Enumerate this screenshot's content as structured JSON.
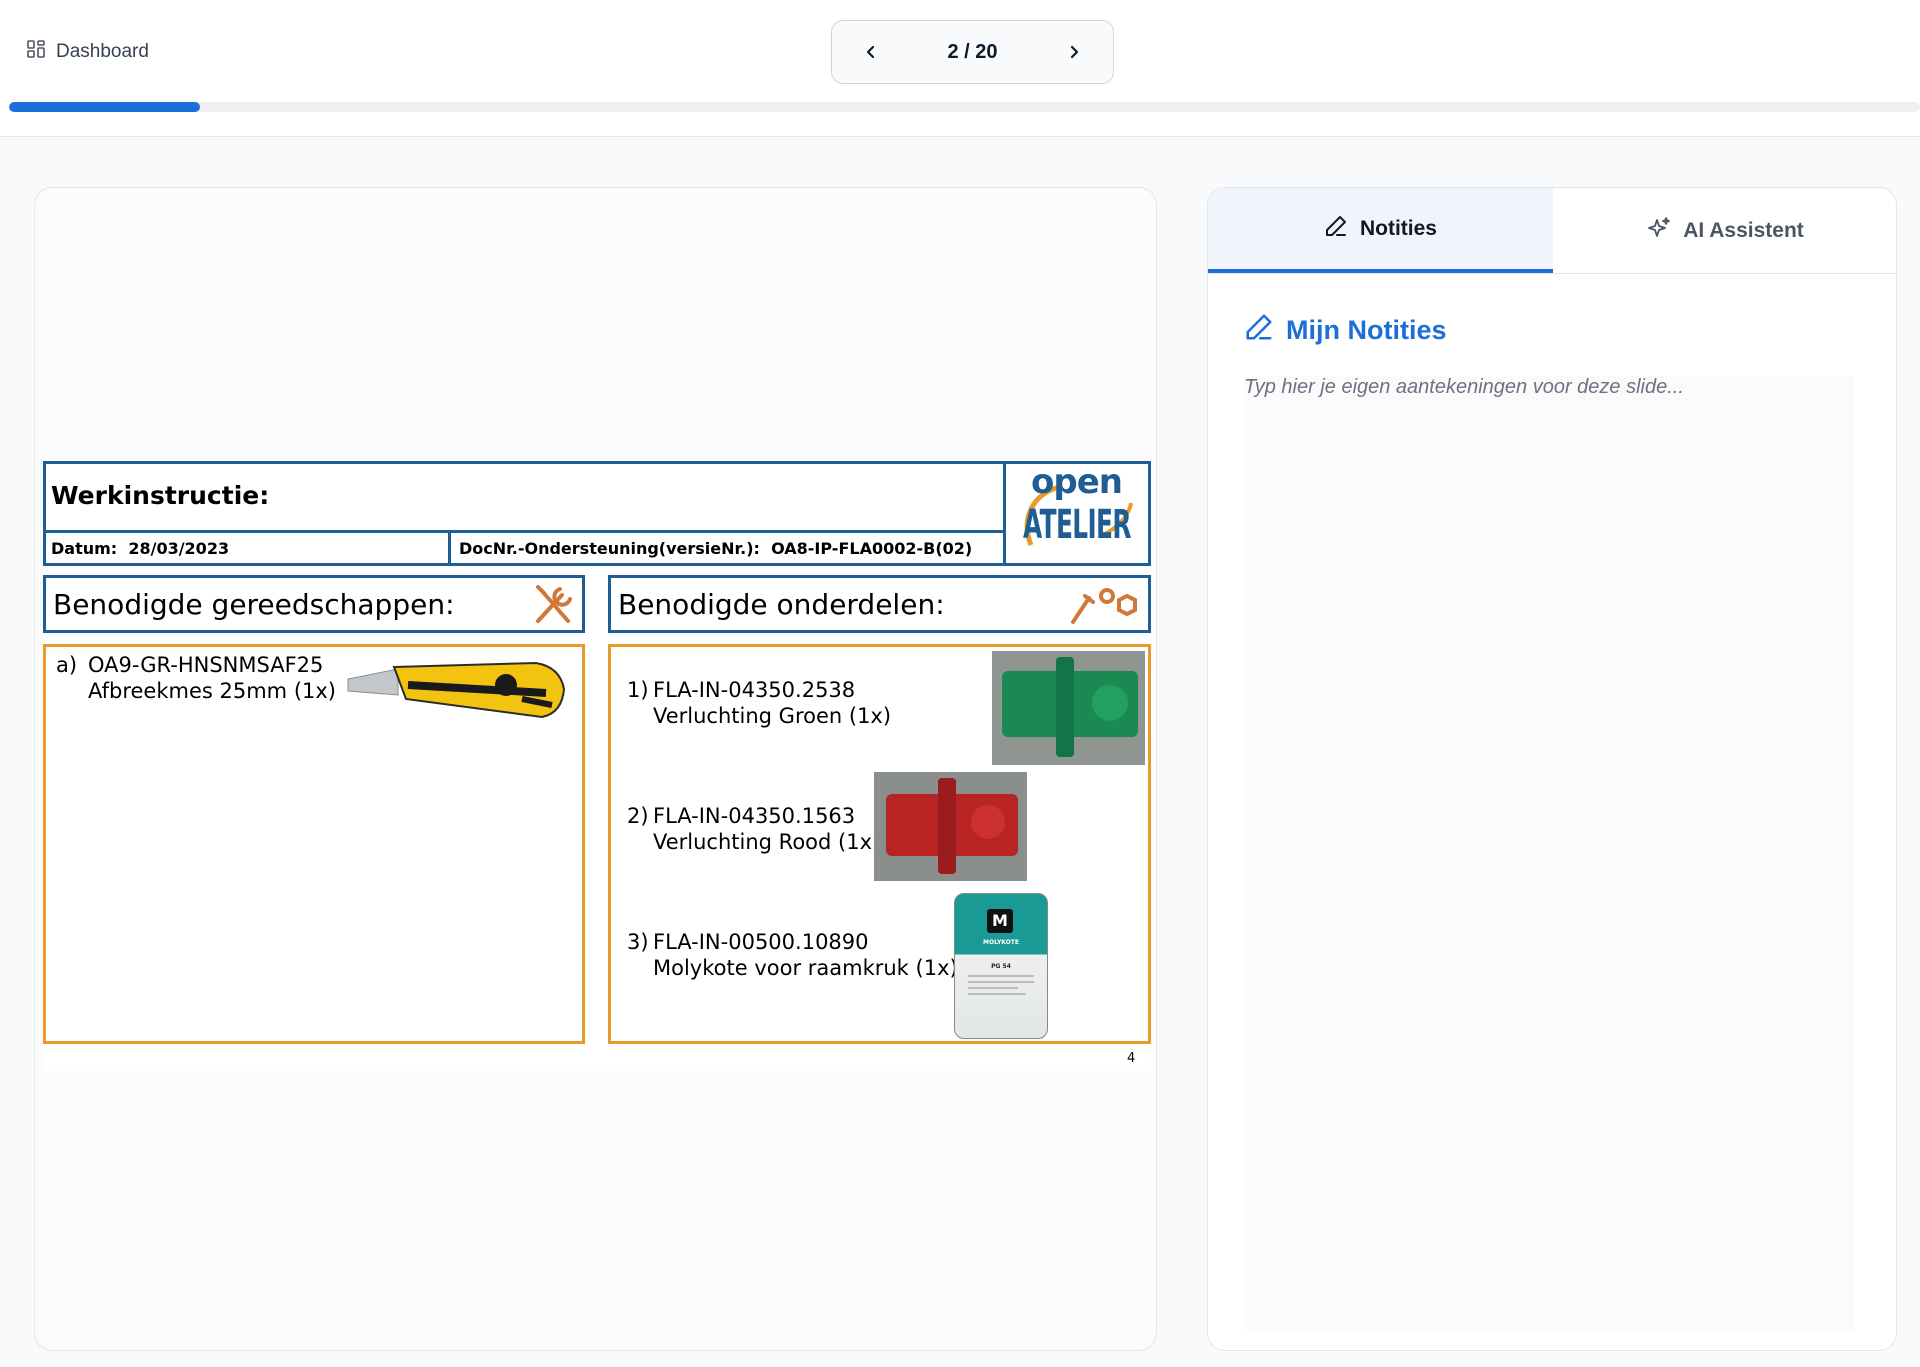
{
  "topbar": {
    "dashboard_label": "Dashboard",
    "page_indicator": "2 / 20",
    "progress_fraction": 0.1
  },
  "slide": {
    "title": "Werkinstructie:",
    "date_label": "Datum:",
    "date_value": "28/03/2023",
    "doc_label": "DocNr.-Ondersteuning(versieNr.):",
    "doc_value": "OA8-IP-FLA0002-B(02)",
    "logo_top": "open",
    "logo_bottom": "ATELIER",
    "tools_header": "Benodigde gereedschappen:",
    "parts_header": "Benodigde onderdelen:",
    "tools": [
      {
        "marker": "a)",
        "code": "OA9-GR-HNSNMSAF25",
        "name": "Afbreekmes 25mm (1x)"
      }
    ],
    "parts": [
      {
        "marker": "1)",
        "code": "FLA-IN-04350.2538",
        "name": "Verluchting Groen (1x)"
      },
      {
        "marker": "2)",
        "code": "FLA-IN-04350.1563",
        "name": "Verluchting Rood (1x)"
      },
      {
        "marker": "3)",
        "code": "FLA-IN-00500.10890",
        "name": "Molykote voor raamkruk (1x)"
      }
    ],
    "can_letter": "M",
    "can_brand": "MOLYKOTE",
    "can_product": "PG 54",
    "page_number": "4"
  },
  "panel": {
    "tab_notes": "Notities",
    "tab_ai": "AI Assistent",
    "notes_title": "Mijn Notities",
    "notes_placeholder": "Typ hier je eigen aantekeningen voor deze slide...",
    "notes_value": ""
  },
  "colors": {
    "accent": "#1d6fd8",
    "slide_blue": "#1f5e94",
    "slide_orange": "#e89a2c"
  },
  "icons": {
    "dashboard": "dashboard-grid-icon",
    "prev": "chevron-left-icon",
    "next": "chevron-right-icon",
    "notes": "pencil-icon",
    "ai": "sparkles-icon",
    "tools": "wrench-screwdriver-icon",
    "parts": "nail-nut-icon"
  }
}
